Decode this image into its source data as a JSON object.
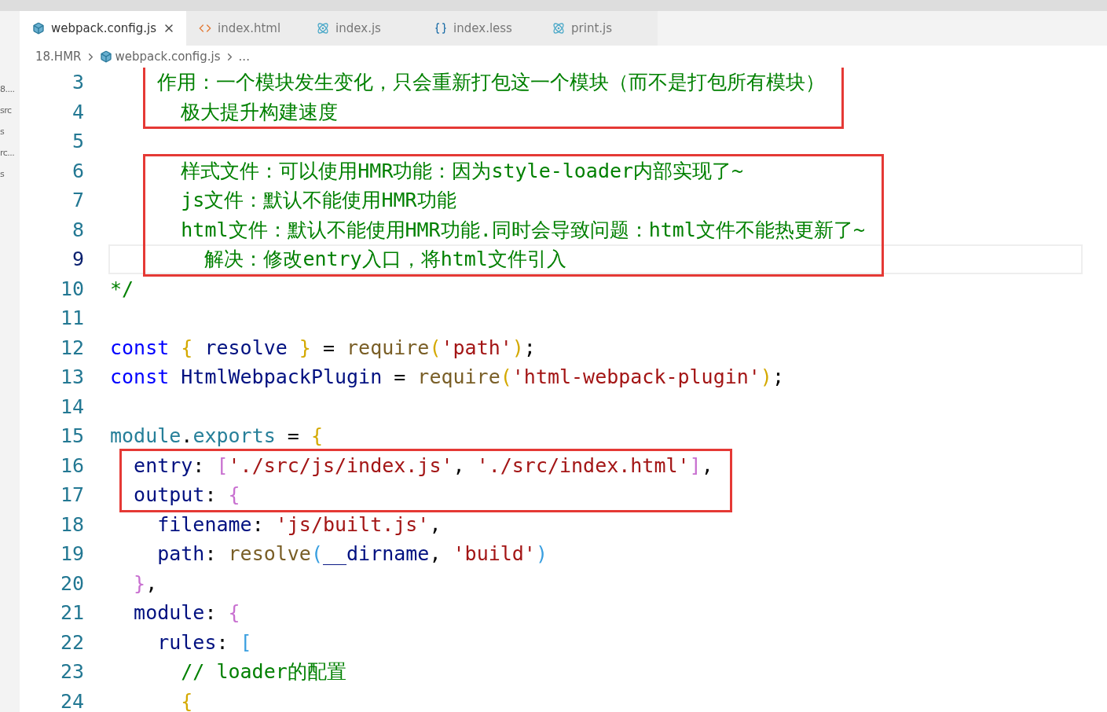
{
  "sidebar": {
    "items": [
      {
        "label": "8...."
      },
      {
        "label": "src"
      },
      {
        "label": "s"
      },
      {
        "label": "rc..."
      },
      {
        "label": "s"
      }
    ]
  },
  "tabs": [
    {
      "label": "webpack.config.js",
      "kind": "config",
      "selected": true
    },
    {
      "label": "index.html",
      "kind": "markup",
      "selected": false
    },
    {
      "label": "index.js",
      "kind": "script",
      "selected": false
    },
    {
      "label": "index.less",
      "kind": "style",
      "selected": false
    },
    {
      "label": "print.js",
      "kind": "script",
      "selected": false
    }
  ],
  "breadcrumb": [
    {
      "label": "18.HMR",
      "kind": "folder"
    },
    {
      "label": "webpack.config.js",
      "kind": "config"
    },
    {
      "label": "...",
      "kind": "more"
    }
  ],
  "blocks": [
    {
      "boxed": true,
      "lines": [
        {
          "number": "3",
          "current": false,
          "tokens": [
            {
              "kind": "comment",
              "text": "    作用：一个模块发生变化，只会重新打包这一个模块（而不是打包所有模块）"
            }
          ]
        },
        {
          "number": "4",
          "current": false,
          "tokens": [
            {
              "kind": "comment",
              "text": "      极大提升构建速度"
            }
          ]
        }
      ]
    },
    {
      "boxed": false,
      "lines": [
        {
          "number": "5",
          "current": false
        }
      ]
    },
    {
      "boxed": true,
      "lines": [
        {
          "number": "6",
          "current": false,
          "tokens": [
            {
              "kind": "comment",
              "text": "      样式文件：可以使用HMR功能：因为style-loader内部实现了~"
            }
          ]
        },
        {
          "number": "7",
          "current": false,
          "tokens": [
            {
              "kind": "comment",
              "text": "      js文件：默认不能使用HMR功能"
            }
          ]
        },
        {
          "number": "8",
          "current": false,
          "tokens": [
            {
              "kind": "comment",
              "text": "      html文件：默认不能使用HMR功能.同时会导致问题：html文件不能热更新了~"
            }
          ]
        },
        {
          "number": "9",
          "current": true,
          "tokens": [
            {
              "kind": "comment",
              "text": "        解决：修改entry入口，将html文件引入"
            }
          ]
        }
      ]
    },
    {
      "boxed": false,
      "lines": [
        {
          "number": "10",
          "current": false,
          "tokens": [
            {
              "kind": "comment",
              "text": "*/"
            }
          ]
        },
        {
          "number": "11",
          "current": false
        },
        {
          "number": "12",
          "current": false,
          "tokens": [
            {
              "kind": "keyword",
              "text": "const"
            },
            {
              "kind": "bracket1",
              "text": " {"
            },
            {
              "kind": "variable",
              "text": " resolve "
            },
            {
              "kind": "bracket1",
              "text": "}"
            },
            {
              "kind": "plain",
              "text": " = "
            },
            {
              "kind": "function",
              "text": "require"
            },
            {
              "kind": "bracket1",
              "text": "("
            },
            {
              "kind": "string",
              "text": "'path'"
            },
            {
              "kind": "bracket1",
              "text": ")"
            },
            {
              "kind": "plain",
              "text": ";"
            }
          ]
        },
        {
          "number": "13",
          "current": false,
          "tokens": [
            {
              "kind": "keyword",
              "text": "const"
            },
            {
              "kind": "variable",
              "text": " HtmlWebpackPlugin"
            },
            {
              "kind": "plain",
              "text": " = "
            },
            {
              "kind": "function",
              "text": "require"
            },
            {
              "kind": "bracket1",
              "text": "("
            },
            {
              "kind": "string",
              "text": "'html-webpack-plugin'"
            },
            {
              "kind": "bracket1",
              "text": ")"
            },
            {
              "kind": "plain",
              "text": ";"
            }
          ]
        },
        {
          "number": "14",
          "current": false
        },
        {
          "number": "15",
          "current": false,
          "tokens": [
            {
              "kind": "object",
              "text": "module"
            },
            {
              "kind": "plain",
              "text": "."
            },
            {
              "kind": "object",
              "text": "exports"
            },
            {
              "kind": "plain",
              "text": " = "
            },
            {
              "kind": "bracket1",
              "text": "{"
            }
          ]
        }
      ]
    },
    {
      "boxed": true,
      "lines": [
        {
          "number": "16",
          "current": false,
          "tokens": [
            {
              "kind": "variable",
              "text": "  entry"
            },
            {
              "kind": "plain",
              "text": ": "
            },
            {
              "kind": "bracket2",
              "text": "["
            },
            {
              "kind": "string",
              "text": "'./src/js/index.js'"
            },
            {
              "kind": "plain",
              "text": ", "
            },
            {
              "kind": "string",
              "text": "'./src/index.html'"
            },
            {
              "kind": "bracket2",
              "text": "]"
            },
            {
              "kind": "plain",
              "text": ","
            }
          ]
        },
        {
          "number": "17",
          "current": false,
          "tokens": [
            {
              "kind": "variable",
              "text": "  output"
            },
            {
              "kind": "plain",
              "text": ": "
            },
            {
              "kind": "bracket2",
              "text": "{"
            }
          ]
        }
      ]
    },
    {
      "boxed": false,
      "lines": [
        {
          "number": "18",
          "current": false,
          "tokens": [
            {
              "kind": "variable",
              "text": "    filename"
            },
            {
              "kind": "plain",
              "text": ": "
            },
            {
              "kind": "string",
              "text": "'js/built.js'"
            },
            {
              "kind": "plain",
              "text": ","
            }
          ]
        },
        {
          "number": "19",
          "current": false,
          "tokens": [
            {
              "kind": "variable",
              "text": "    path"
            },
            {
              "kind": "plain",
              "text": ": "
            },
            {
              "kind": "function",
              "text": "resolve"
            },
            {
              "kind": "bracket3",
              "text": "("
            },
            {
              "kind": "variable",
              "text": "__dirname"
            },
            {
              "kind": "plain",
              "text": ", "
            },
            {
              "kind": "string",
              "text": "'build'"
            },
            {
              "kind": "bracket3",
              "text": ")"
            }
          ]
        },
        {
          "number": "20",
          "current": false,
          "tokens": [
            {
              "kind": "bracket2",
              "text": "  }"
            },
            {
              "kind": "plain",
              "text": ","
            }
          ]
        },
        {
          "number": "21",
          "current": false,
          "tokens": [
            {
              "kind": "variable",
              "text": "  module"
            },
            {
              "kind": "plain",
              "text": ": "
            },
            {
              "kind": "bracket2",
              "text": "{"
            }
          ]
        },
        {
          "number": "22",
          "current": false,
          "tokens": [
            {
              "kind": "variable",
              "text": "    rules"
            },
            {
              "kind": "plain",
              "text": ": "
            },
            {
              "kind": "bracket3",
              "text": "["
            }
          ]
        },
        {
          "number": "23",
          "current": false,
          "tokens": [
            {
              "kind": "comment",
              "text": "      // loader的配置"
            }
          ]
        },
        {
          "number": "24",
          "current": false,
          "tokens": [
            {
              "kind": "bracket1",
              "text": "      {"
            }
          ]
        }
      ]
    }
  ]
}
